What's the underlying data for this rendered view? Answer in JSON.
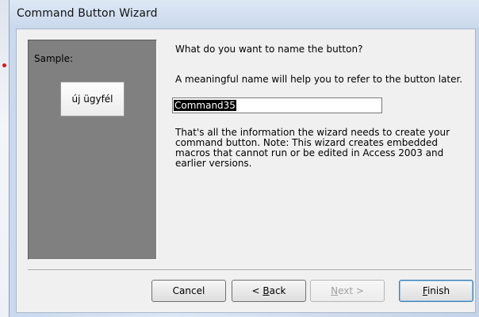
{
  "window": {
    "title": "Command Button Wizard"
  },
  "sample": {
    "label": "Sample:",
    "button_caption": "új ügyfél"
  },
  "prompt": {
    "question": "What do you want to name the button?",
    "hint": "A meaningful name will help you to refer to the button later."
  },
  "name_field": {
    "value": "Command35"
  },
  "info": {
    "text": "That's all the information the wizard needs to create your command button. Note: This wizard creates embedded macros that cannot run or be edited in Access 2003 and earlier versions."
  },
  "buttons": {
    "cancel": "Cancel",
    "back_prefix": "< ",
    "back_mnemonic": "B",
    "back_rest": "ack",
    "next_mnemonic": "N",
    "next_rest": "ext >",
    "finish_mnemonic": "F",
    "finish_rest": "inish"
  },
  "colors": {
    "sample_panel": "#808080",
    "default_button_border": "#3c7fb1",
    "selection": "#000000"
  },
  "icons": {
    "marker": "red-dot-marker"
  }
}
